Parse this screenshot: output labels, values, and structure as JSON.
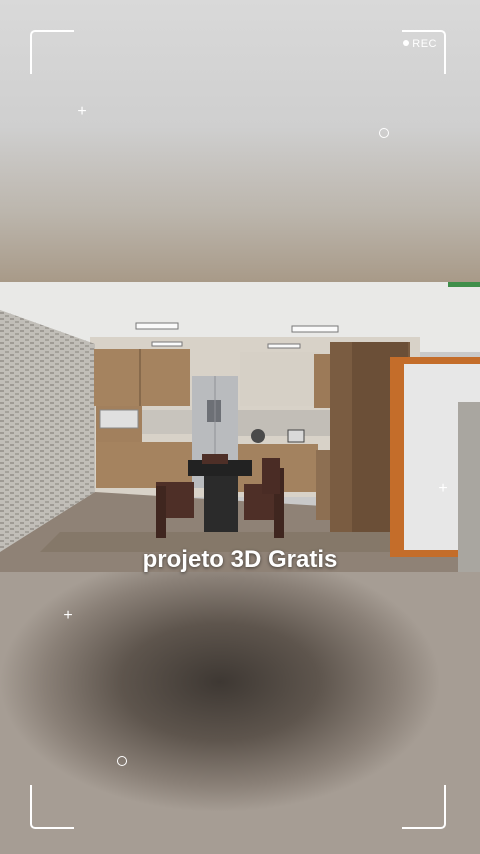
{
  "overlay": {
    "rec_label": "REC",
    "caption": "projeto 3D Gratis"
  },
  "icons": {
    "plus": "+",
    "rec_dot": "record-dot-icon"
  },
  "colors": {
    "frame": "#ffffff",
    "caption": "#ffffff",
    "wood": "#9c7a58",
    "floor": "#8f8276"
  }
}
